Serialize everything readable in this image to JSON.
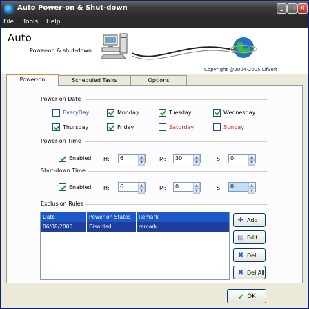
{
  "window": {
    "title": "Auto Power-on & Shut-down"
  },
  "menu": [
    "File",
    "Tools",
    "Help"
  ],
  "banner": {
    "app_name": "Auto",
    "subtitle": "Power-on & shut-down",
    "copyright": "Copyright @2004-2005 LifSoft"
  },
  "tabs": [
    {
      "label": "Power-on",
      "active": true
    },
    {
      "label": "Scheduled Tasks",
      "active": false
    },
    {
      "label": "Options",
      "active": false
    }
  ],
  "power_on_date": {
    "group_label": "Power-on Date",
    "days": [
      {
        "label": "EveryDay",
        "checked": false,
        "color": "#2350b8"
      },
      {
        "label": "Monday",
        "checked": true
      },
      {
        "label": "Tuesday",
        "checked": true
      },
      {
        "label": "Wednesday",
        "checked": true
      },
      {
        "label": "Thursday",
        "checked": true
      },
      {
        "label": "Friday",
        "checked": true
      },
      {
        "label": "Saturday",
        "checked": false,
        "color": "#d02020"
      },
      {
        "label": "Sunday",
        "checked": false,
        "color": "#d02020"
      }
    ]
  },
  "power_on_time": {
    "group_label": "Power-on Time",
    "enabled_label": "Enabled",
    "enabled": true,
    "h_label": "H:",
    "h_value": "6",
    "m_label": "M:",
    "m_value": "30",
    "s_label": "S:",
    "s_value": "0"
  },
  "shutdown_time": {
    "group_label": "Shut-down Time",
    "enabled_label": "Enabled",
    "enabled": true,
    "h_label": "H:",
    "h_value": "6",
    "m_label": "M:",
    "m_value": "0",
    "s_label": "S:",
    "s_value": "0"
  },
  "exclusion_rules": {
    "group_label": "Exclusion Rules",
    "columns": [
      "Date",
      "Power-on States",
      "Remark"
    ],
    "rows": [
      {
        "date": "06/08/2005",
        "state": "Disabled",
        "remark": "remark"
      }
    ],
    "buttons": {
      "add": "Add",
      "edit": "Edit",
      "del": "Del",
      "del_all": "Del All"
    }
  },
  "ok_label": "OK",
  "colors": {
    "accent_tab": "#e68b2c",
    "table_header": "#1d59c6",
    "selected_row": "#1f3f9e"
  }
}
